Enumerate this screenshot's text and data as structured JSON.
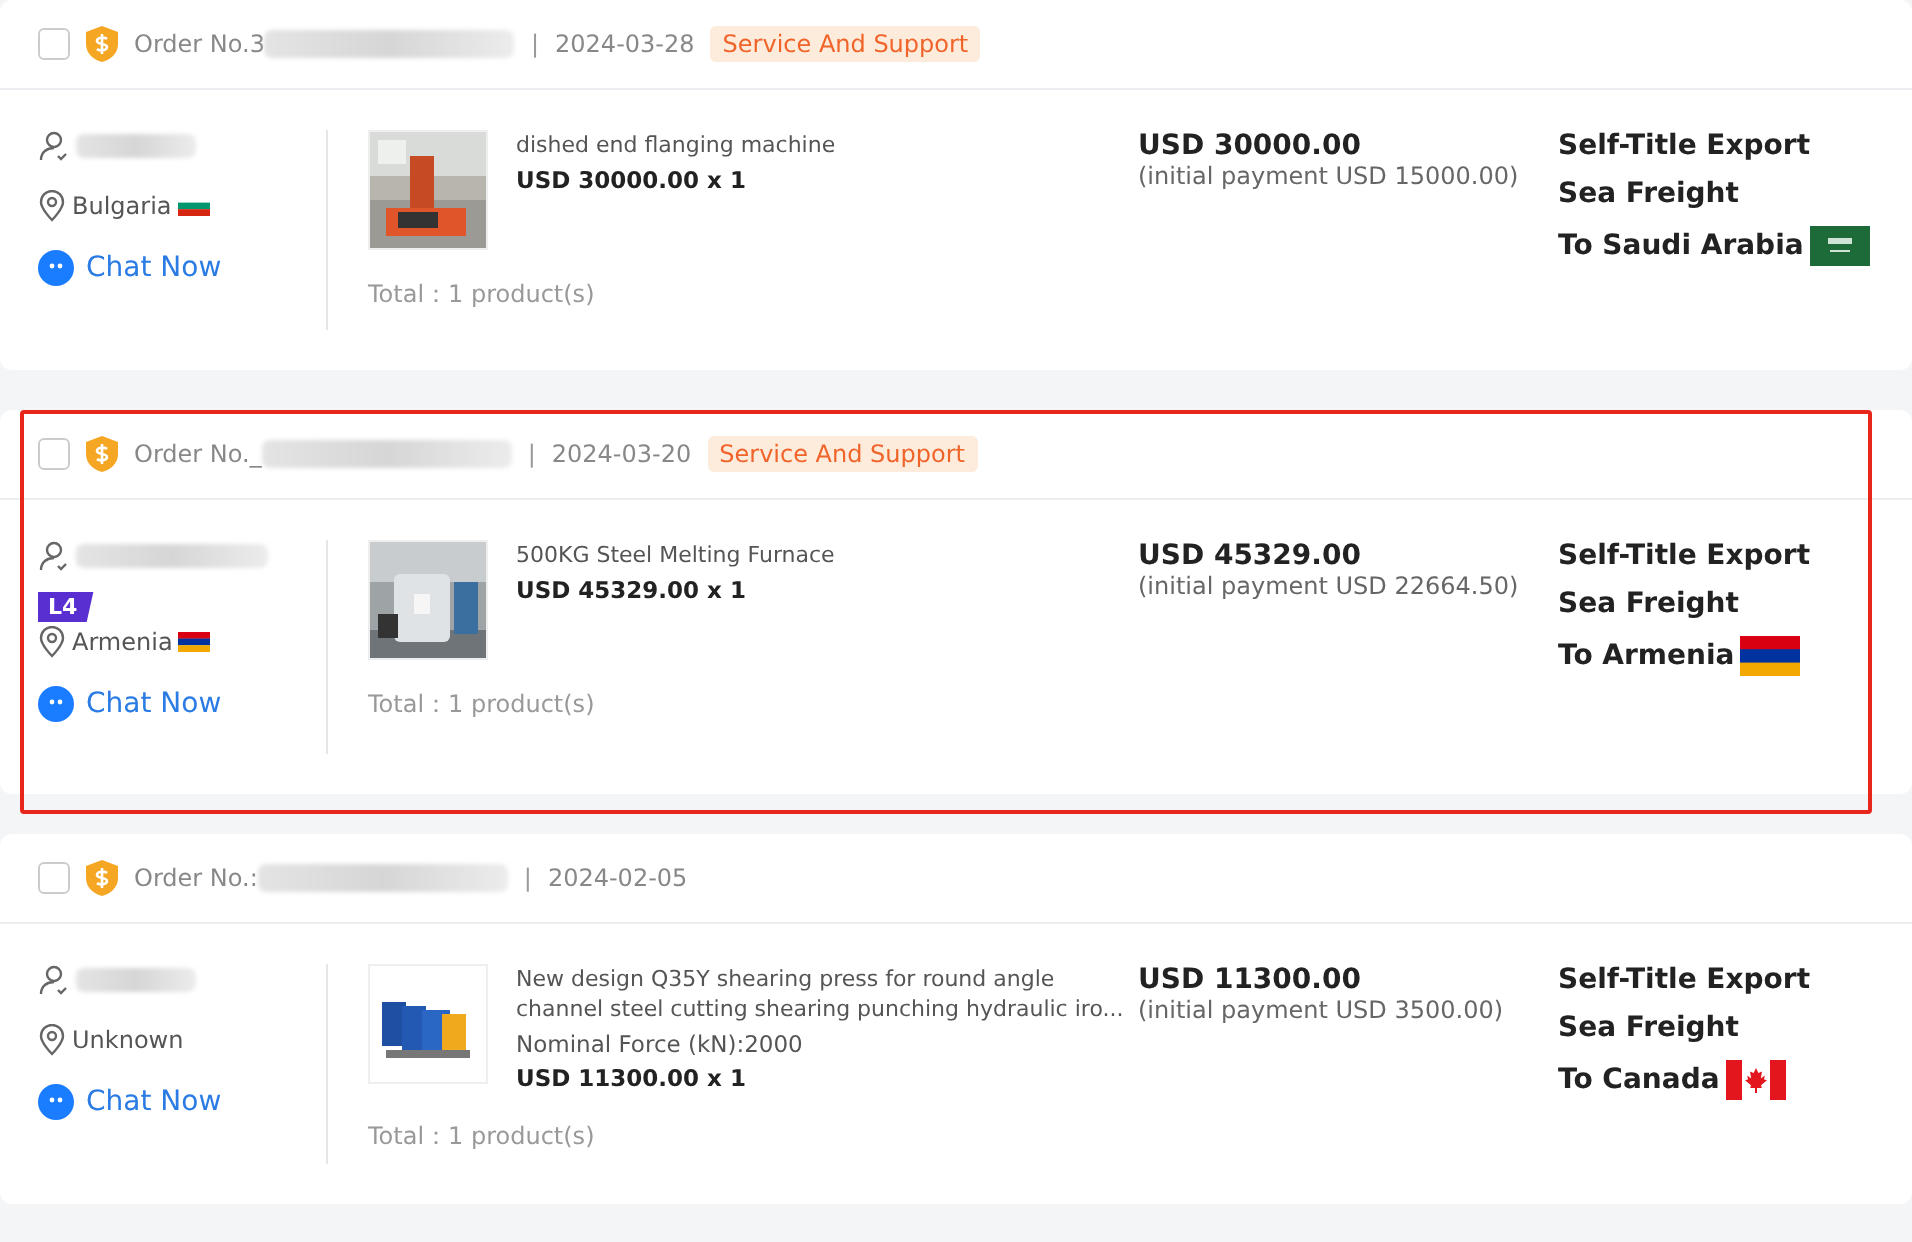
{
  "orders": [
    {
      "order_no": "Order No.3",
      "separator": "|",
      "date": "2024-03-28",
      "tag": "Service And Support",
      "highlighted": false,
      "checked": false,
      "country": "Bulgaria",
      "chat": "Chat Now",
      "product": {
        "name": "dished end flanging machine",
        "price_qty": "USD 30000.00 x 1"
      },
      "total": "Total：1 product(s)",
      "amount": "USD 30000.00",
      "initial_payment": "(initial payment USD 15000.00)",
      "shipping": [
        "Self-Title Export",
        "Sea Freight"
      ],
      "destination": "To Saudi Arabia"
    },
    {
      "order_no": "Order No._",
      "separator": "|",
      "date": "2024-03-20",
      "tag": "Service And Support",
      "highlighted": true,
      "checked": false,
      "level_badge": "L4",
      "country": "Armenia",
      "chat": "Chat Now",
      "product": {
        "name": "500KG Steel Melting Furnace",
        "price_qty": "USD 45329.00 x 1"
      },
      "total": "Total：1 product(s)",
      "amount": "USD 45329.00",
      "initial_payment": "(initial payment USD 22664.50)",
      "shipping": [
        "Self-Title Export",
        "Sea Freight"
      ],
      "destination": "To Armenia"
    },
    {
      "order_no": "Order No.:",
      "separator": "|",
      "date": "2024-02-05",
      "highlighted": false,
      "checked": false,
      "country": "Unknown",
      "chat": "Chat Now",
      "product": {
        "name": "New design Q35Y shearing press for round angle channel steel cutting shearing punching hydraulic iro...",
        "spec": "Nominal Force (kN):2000",
        "price_qty": "USD 11300.00 x 1"
      },
      "total": "Total：1 product(s)",
      "amount": "USD 11300.00",
      "initial_payment": "(initial payment USD 3500.00)",
      "shipping": [
        "Self-Title Export",
        "Sea Freight"
      ],
      "destination": "To Canada"
    }
  ]
}
